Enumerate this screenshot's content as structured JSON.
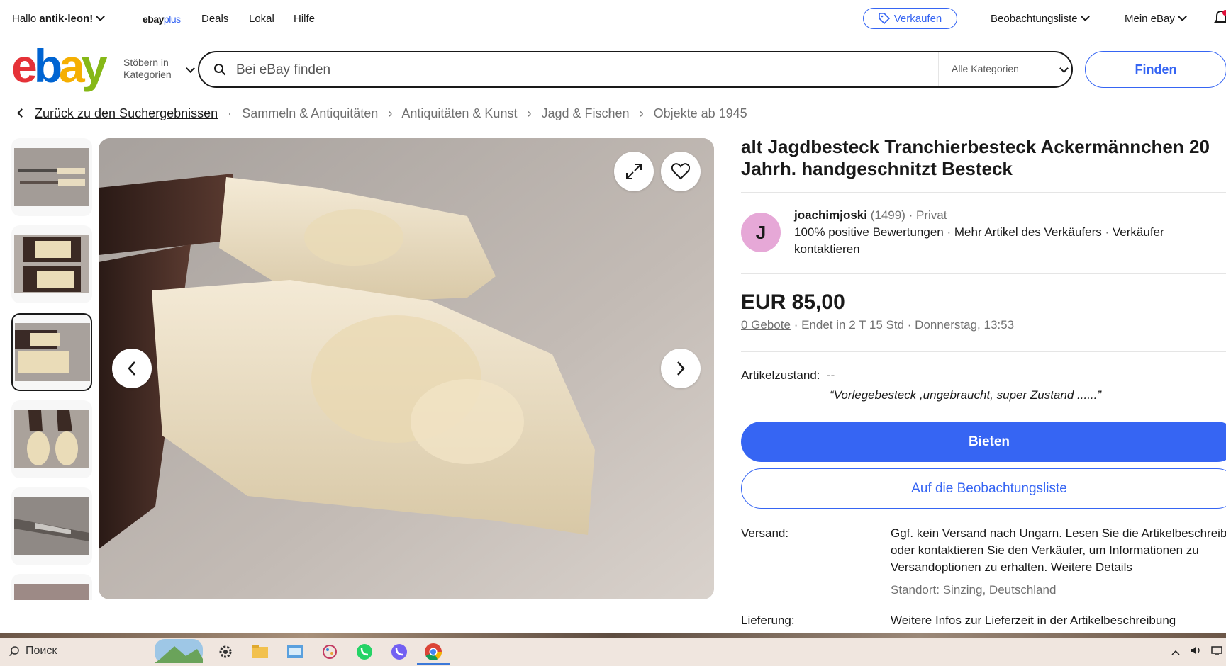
{
  "topbar": {
    "greeting_prefix": "Hallo",
    "user": "antik-leon!",
    "plus_a": "ebay",
    "plus_b": "plus",
    "links": [
      "Deals",
      "Lokal",
      "Hilfe"
    ],
    "sell": "Verkaufen",
    "watchlist": "Beobachtungsliste",
    "my_ebay": "Mein eBay"
  },
  "header": {
    "logo": {
      "e": "e",
      "b": "b",
      "a": "a",
      "y": "y"
    },
    "browse_line1": "Stöbern in",
    "browse_line2": "Kategorien",
    "search_placeholder": "Bei eBay finden",
    "category": "Alle Kategorien",
    "find": "Finden"
  },
  "breadcrumb": {
    "back": "Zurück zu den Suchergebnissen",
    "items": [
      "Sammeln & Antiquitäten",
      "Antiquitäten & Kunst",
      "Jagd & Fischen",
      "Objekte ab 1945"
    ]
  },
  "gallery": {
    "thumb_count": 6,
    "selected_index": 2
  },
  "listing": {
    "title": "alt Jagdbesteck Tranchierbesteck Ackermännchen 20 Jahrh. handgeschnitzt Besteck",
    "seller": {
      "avatar_letter": "J",
      "name": "joachimjoski",
      "score": "(1499)",
      "type": "Privat",
      "feedback": "100% positive Bewertungen",
      "more_items": "Mehr Artikel des Verkäufers",
      "contact": "Verkäufer kontaktieren"
    },
    "price": "EUR 85,00",
    "bids": "0 Gebote",
    "ends": "Endet in 2 T 15 Std",
    "end_time": "Donnerstag, 13:53",
    "condition_label": "Artikelzustand:",
    "condition_value": "--",
    "condition_quote": "“Vorlegebesteck ,ungebraucht, super Zustand ......”",
    "bid_button": "Bieten",
    "watch_button": "Auf die Beobachtungsliste",
    "shipping_label": "Versand:",
    "shipping_text1": "Ggf. kein Versand nach Ungarn. Lesen Sie die Artikelbeschreibung",
    "shipping_text2": "oder",
    "shipping_link": "kontaktieren Sie den Verkäufer",
    "shipping_text3": ", um Informationen zu Versandoptionen zu erhalten.",
    "shipping_more": "Weitere Details",
    "location": "Standort: Sinzing, Deutschland",
    "delivery_label": "Lieferung:",
    "delivery_text": "Weitere Infos zur Lieferzeit in der Artikelbeschreibung"
  },
  "taskbar": {
    "search": "Поиск"
  },
  "colors": {
    "accent": "#3665f3",
    "avatar": "#e6a8d7"
  }
}
